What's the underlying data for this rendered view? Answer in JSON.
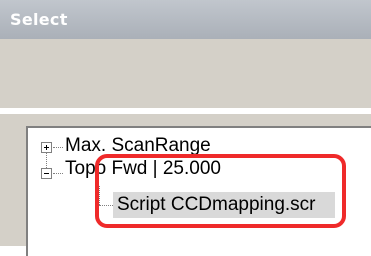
{
  "window": {
    "title": "Select"
  },
  "tree": {
    "items": [
      {
        "label": "Max. ScanRange",
        "expander": "plus"
      },
      {
        "label": "Topo  Fwd  | 25.000",
        "expander": "minus"
      },
      {
        "label": "Script  CCDmapping.scr",
        "selected": true
      }
    ]
  },
  "colors": {
    "titlebar": "#b0b6be",
    "panel": "#d4d0c8",
    "selection": "#d9d9d9",
    "highlight": "#ef2a2a"
  }
}
